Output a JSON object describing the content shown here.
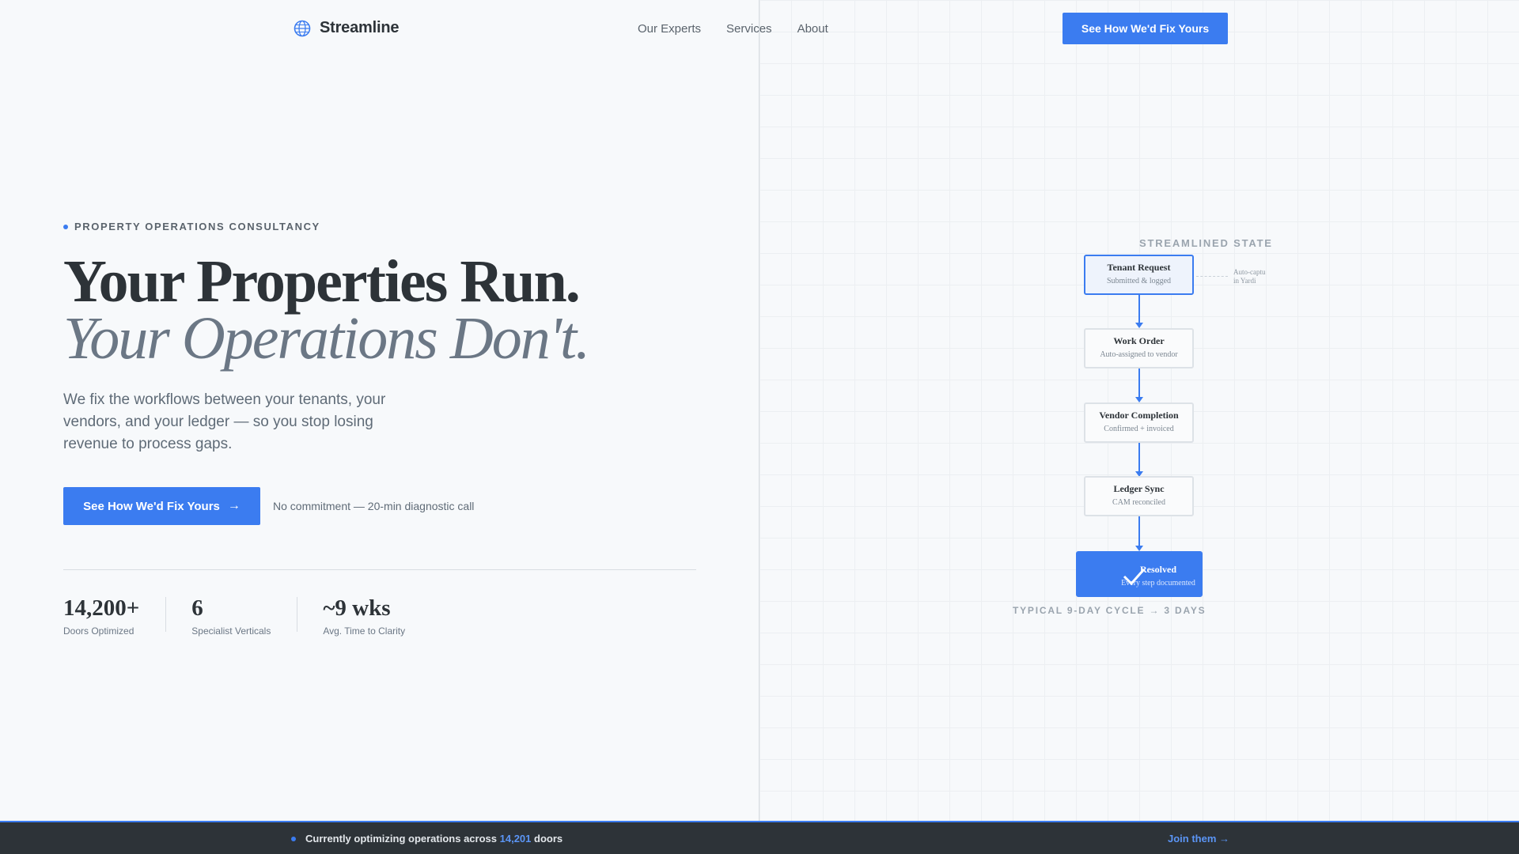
{
  "header": {
    "brand": "Streamline",
    "nav": [
      "Our Experts",
      "Services",
      "About"
    ],
    "cta_label": "See How We'd Fix Yours"
  },
  "hero": {
    "eyebrow": "PROPERTY OPERATIONS CONSULTANCY",
    "headline_line1": "Your Properties Run.",
    "headline_line2": "Your Operations Don't.",
    "lede": "We fix the workflows between your tenants, your vendors, and your ledger — so you stop losing revenue to process gaps.",
    "cta_label": "See How We'd Fix Yours",
    "cta_arrow": "→",
    "cta_note": "No commitment — 20-min diagnostic call"
  },
  "stats": [
    {
      "value": "14,200+",
      "label": "Doors Optimized"
    },
    {
      "value": "6",
      "label": "Specialist Verticals"
    },
    {
      "value": "~9 wks",
      "label": "Avg. Time to Clarity"
    }
  ],
  "flow": {
    "title": "STREAMLINED STATE",
    "side_note_line1": "Auto-captu",
    "side_note_line2": "in Yardi",
    "nodes": [
      {
        "title": "Tenant Request",
        "subtitle": "Submitted & logged"
      },
      {
        "title": "Work Order",
        "subtitle": "Auto-assigned to vendor"
      },
      {
        "title": "Vendor Completion",
        "subtitle": "Confirmed + invoiced"
      },
      {
        "title": "Ledger Sync",
        "subtitle": "CAM reconciled"
      },
      {
        "title": "Resolved",
        "subtitle": "Every step documented"
      }
    ],
    "cycle_caption": "TYPICAL 9-DAY CYCLE → 3 DAYS"
  },
  "footer": {
    "text_before": "Currently optimizing operations across",
    "doors_count": "14,201",
    "text_after": "doors",
    "join_label": "Join them →"
  },
  "colors": {
    "accent": "#3b7cf0",
    "ink": "#2d3338",
    "muted": "#6b7785",
    "footer_bg": "#2d3338"
  }
}
